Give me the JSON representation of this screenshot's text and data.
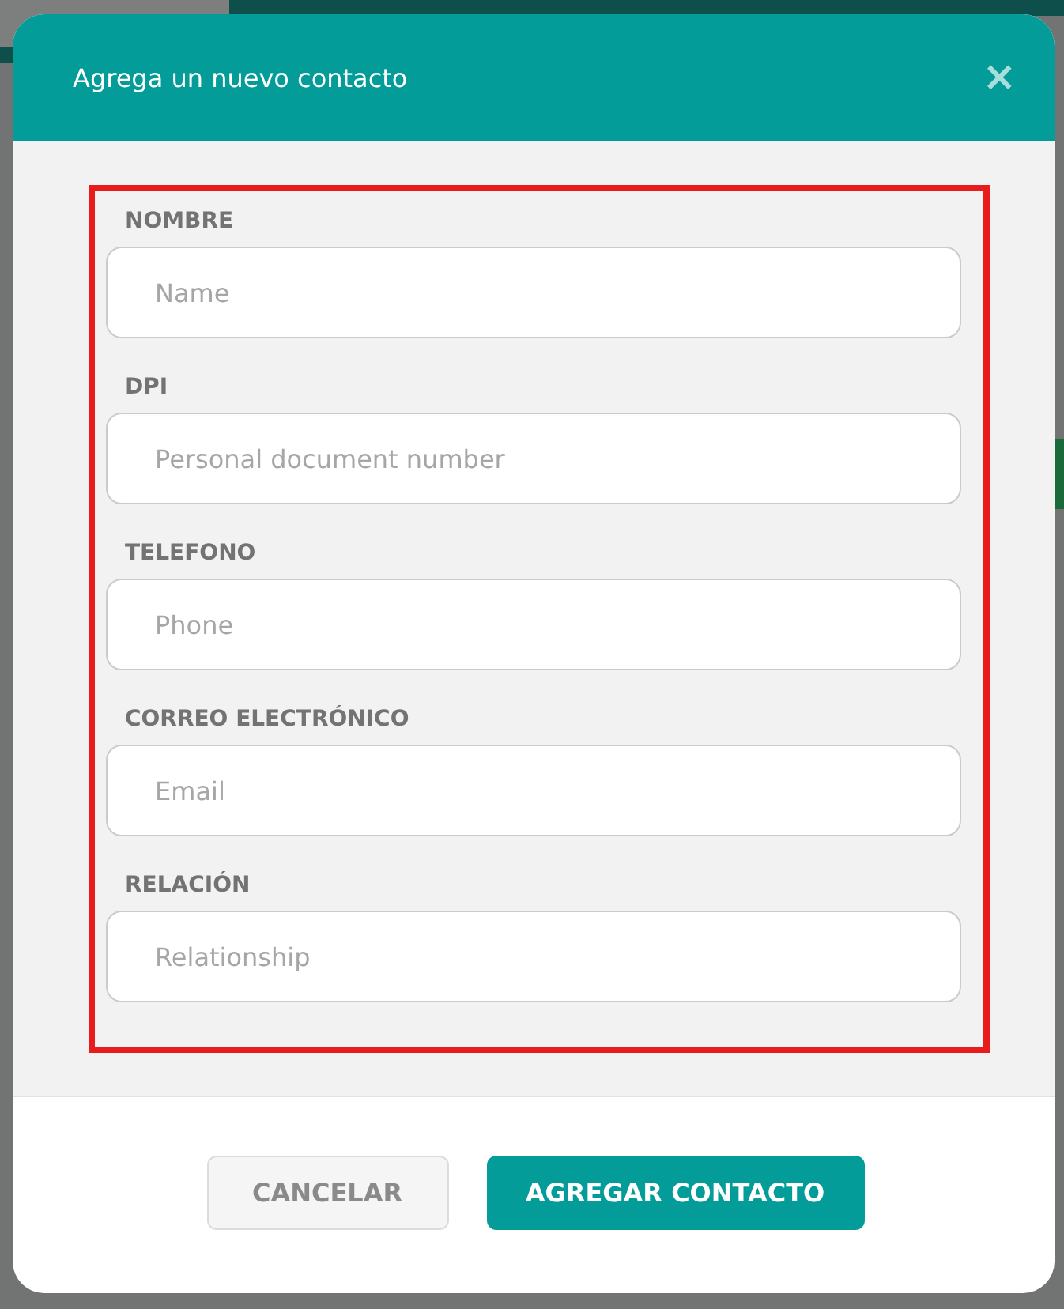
{
  "dialog": {
    "title": "Agrega un nuevo contacto",
    "close_icon": "×"
  },
  "fields": [
    {
      "label": "NOMBRE",
      "placeholder": "Name"
    },
    {
      "label": "DPI",
      "placeholder": "Personal document number"
    },
    {
      "label": "TELEFONO",
      "placeholder": "Phone"
    },
    {
      "label": "CORREO ELECTRÓNICO",
      "placeholder": "Email"
    },
    {
      "label": "RELACIÓN",
      "placeholder": "Relationship"
    }
  ],
  "buttons": [
    {
      "kind": "secondary",
      "label": "CANCELAR"
    },
    {
      "kind": "primary",
      "label": "AGREGAR CONTACTO"
    }
  ]
}
